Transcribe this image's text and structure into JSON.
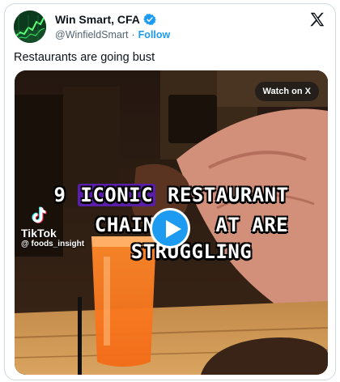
{
  "author": {
    "display_name": "Win Smart, CFA",
    "handle": "@WinfieldSmart",
    "separator": "·",
    "follow_label": "Follow",
    "verified": true
  },
  "tweet": {
    "text": "Restaurants are going bust"
  },
  "video": {
    "watch_label": "Watch on X",
    "overlay": {
      "line1_prefix": "9",
      "line1_highlight": "ICONIC",
      "line1_suffix": "RESTAURANT",
      "line2_left": "CHAINS",
      "line2_right": "AT ARE",
      "line3": "STRUGGLING"
    },
    "tiktok": {
      "brand": "TikTok",
      "username": "@ foods_insight"
    }
  },
  "colors": {
    "accent": "#1d9bf0",
    "verified": "#1d9bf0",
    "highlight": "#5a1ea8"
  }
}
